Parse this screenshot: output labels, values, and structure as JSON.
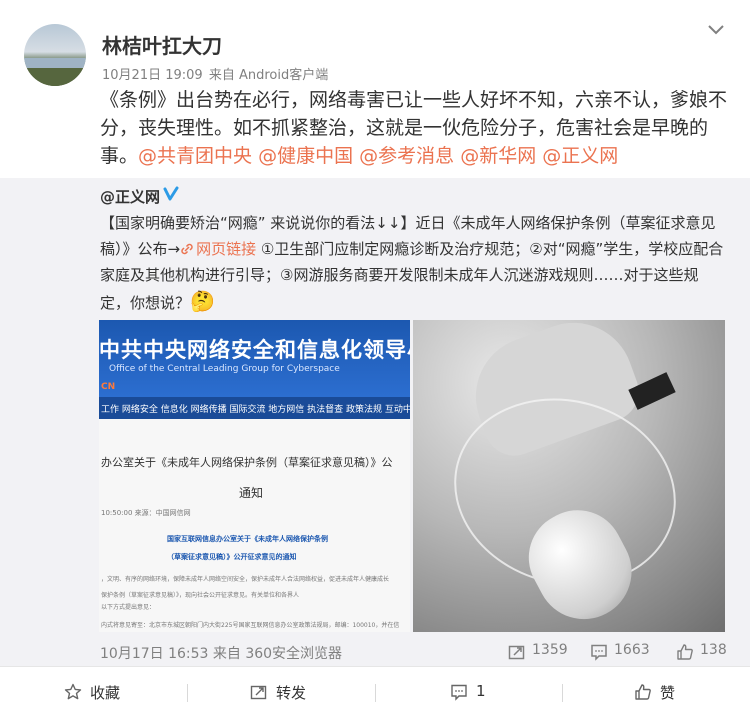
{
  "author": {
    "name": "林桔叶扛大刀",
    "time": "10月21日 19:09",
    "source": "来自 Android客户端"
  },
  "post": {
    "text": "《条例》出台势在必行，网络毒害已让一些人好坏不知，六亲不认，爹娘不分，丧失理性。如不抓紧整治，这就是一伙危险分子，危害社会是早晚的事。",
    "mentions": [
      "@共青团中央",
      "@健康中国",
      "@参考消息",
      "@新华网",
      "@正义网"
    ]
  },
  "repost": {
    "author": "@正义网",
    "text_part1": "【国家明确要矫治“网瘾” 来说说你的看法↓↓】近日《未成年人网络保护条例（草案征求意见稿）》公布→",
    "link_label": "网页链接",
    "text_part2": " ①卫生部门应制定网瘾诊断及治疗规范；②对“网瘾”学生，学校应配合家庭及其他机构进行引导；③网游服务商要开发限制未成年人沉迷游戏规则……对于这些规定，你想说？",
    "emoji": "🤔",
    "time": "10月17日 16:53",
    "source": "来自 360安全浏览器",
    "reposts": "1359",
    "comments": "1663",
    "likes": "138",
    "image1": {
      "title": "中共中央网络安全和信息化领导小",
      "subtitle": "Office of the Central Leading Group for Cyberspace",
      "cn": "CN",
      "nav": "工作 网络安全 信息化 网络传播 国际交流 地方网信 执法督查 政策法规 互动中心 专",
      "headline": "办公室关于《未成年人网络保护条例（草案征求意见稿）》公",
      "notice": "通知",
      "date": "10:50:00  来源：中国网信网",
      "body1": "国家互联网信息办公室关于《未成年人网络保护条例",
      "body2": "（草案征求意见稿）》公开征求意见的通知",
      "small1": "，文明、有序的网络环境，保障未成年人网络空间安全，保护未成年人合法网络权益，促进未成年人健康成长",
      "small2": "保护条例（草案征求意见稿）》，现向社会公开征求意见。有关单位和各界人",
      "small3": "以下方式提出意见：",
      "small4": "内式将意见寄至：北京市东城区朝阳门内大街225号国家互联网信息办公室政策法规局，邮编：100010，并在信"
    }
  },
  "footer": {
    "favorite": "收藏",
    "forward": "转发",
    "comment_count": "1",
    "like": "赞"
  }
}
